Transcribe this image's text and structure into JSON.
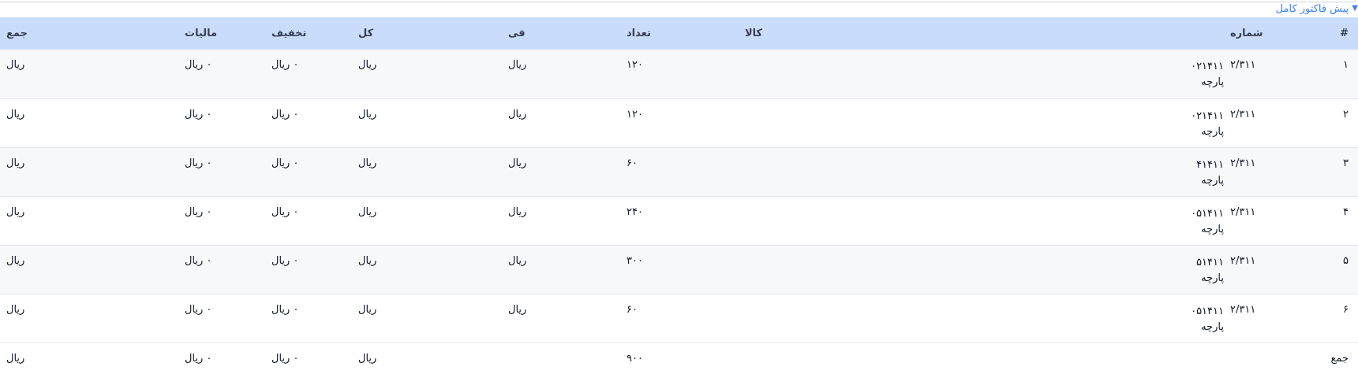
{
  "summary": {
    "label": "پیش فاکتور کامل",
    "caret": "▼"
  },
  "columns": {
    "num": "#",
    "invoice": "شماره",
    "product": "کالا",
    "qty": "تعداد",
    "unit_price": "فی",
    "amount": "کل",
    "discount": "تخفیف",
    "tax": "مالیات",
    "total": "جمع"
  },
  "rows": [
    {
      "num": "۱",
      "invoice": "۲/۳۱۱",
      "code": "۰۲۱۴۱۱",
      "unit": "پارچه",
      "qty": "۱۲۰",
      "unit_price": "ریال",
      "amount": "ریال",
      "discount": "۰ ریال",
      "tax": "۰ ریال",
      "total": "ریال"
    },
    {
      "num": "۲",
      "invoice": "۲/۳۱۱",
      "code": "۰۲۱۴۱۱",
      "unit": "پارچه",
      "qty": "۱۲۰",
      "unit_price": "ریال",
      "amount": "ریال",
      "discount": "۰ ریال",
      "tax": "۰ ریال",
      "total": "ریال"
    },
    {
      "num": "۳",
      "invoice": "۲/۳۱۱",
      "code": "۴۱۴۱۱",
      "unit": "پارچه",
      "qty": "۶۰",
      "unit_price": "ریال",
      "amount": "ریال",
      "discount": "۰ ریال",
      "tax": "۰ ریال",
      "total": "ریال"
    },
    {
      "num": "۴",
      "invoice": "۲/۳۱۱",
      "code": "۰۵۱۴۱۱",
      "unit": "پارچه",
      "qty": "۲۴۰",
      "unit_price": "ریال",
      "amount": "ریال",
      "discount": "۰ ریال",
      "tax": "۰ ریال",
      "total": "ریال"
    },
    {
      "num": "۵",
      "invoice": "۲/۳۱۱",
      "code": "۵۱۴۱۱",
      "unit": "پارچه",
      "qty": "۳۰۰",
      "unit_price": "ریال",
      "amount": "ریال",
      "discount": "۰ ریال",
      "tax": "۰ ریال",
      "total": "ریال"
    },
    {
      "num": "۶",
      "invoice": "۲/۳۱۱",
      "code": "۰۵۱۴۱۱",
      "unit": "پارچه",
      "qty": "۶۰",
      "unit_price": "ریال",
      "amount": "ریال",
      "discount": "۰ ریال",
      "tax": "۰ ریال",
      "total": "ریال"
    }
  ],
  "totals": {
    "label": "جمع",
    "qty": "۹۰۰",
    "amount": "ریال",
    "discount": "۰ ریال",
    "tax": "۰ ریال",
    "total": "ریال"
  }
}
